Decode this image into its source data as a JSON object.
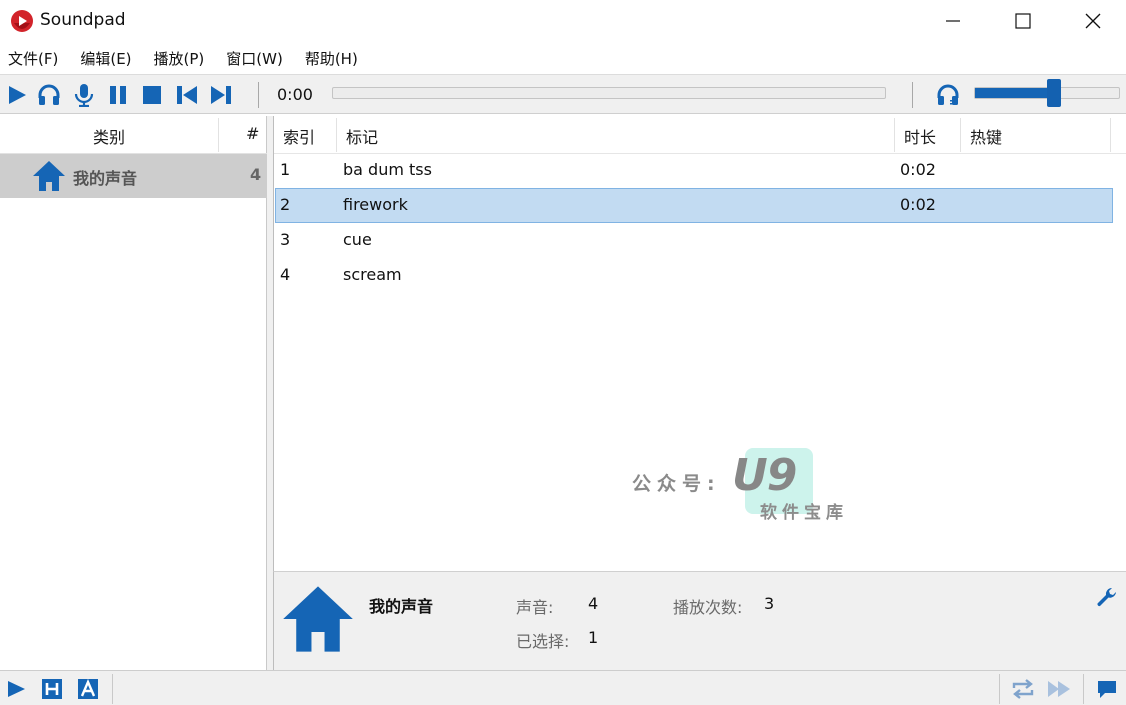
{
  "window": {
    "title": "Soundpad",
    "controls": [
      "minimize",
      "maximize",
      "close"
    ]
  },
  "menu": [
    "文件(F)",
    "编辑(E)",
    "播放(P)",
    "窗口(W)",
    "帮助(H)"
  ],
  "toolbar": {
    "buttons": [
      "play-icon",
      "headphones-icon",
      "microphone-icon",
      "pause-icon",
      "stop-icon",
      "previous-icon",
      "next-icon"
    ],
    "time": "0:00",
    "seek_progress": 0,
    "volume_level": 0.55
  },
  "categories": {
    "header_label": "类别",
    "header_count": "#",
    "items": [
      {
        "name": "我的声音",
        "count": "4",
        "icon": "home-icon"
      }
    ]
  },
  "sounds": {
    "columns": [
      "索引",
      "标记",
      "时长",
      "热键"
    ],
    "rows": [
      {
        "index": "1",
        "tag": "ba dum tss",
        "duration": "0:02",
        "hotkey": ""
      },
      {
        "index": "2",
        "tag": "firework",
        "duration": "0:02",
        "hotkey": "",
        "selected": true
      },
      {
        "index": "3",
        "tag": "cue",
        "duration": "",
        "hotkey": ""
      },
      {
        "index": "4",
        "tag": "scream",
        "duration": "",
        "hotkey": ""
      }
    ]
  },
  "info": {
    "category_name": "我的声音",
    "sounds_label": "声音:",
    "sounds_value": "4",
    "plays_label": "播放次数:",
    "plays_value": "3",
    "selected_label": "已选择:",
    "selected_value": "1"
  },
  "watermark": {
    "text": "公众号:",
    "logo": "U9",
    "subtitle": "软件宝库"
  },
  "statusbar": {
    "left_buttons": [
      "play-icon",
      "h-box-icon",
      "a-box-icon"
    ],
    "right_buttons": [
      "repeat-icon",
      "fast-forward-icon",
      "chat-icon"
    ]
  },
  "colors": {
    "accent": "#1565b5",
    "selection": "#c2dbf2",
    "category_selected": "#cdcdcd",
    "logo_red": "#d2232a"
  }
}
